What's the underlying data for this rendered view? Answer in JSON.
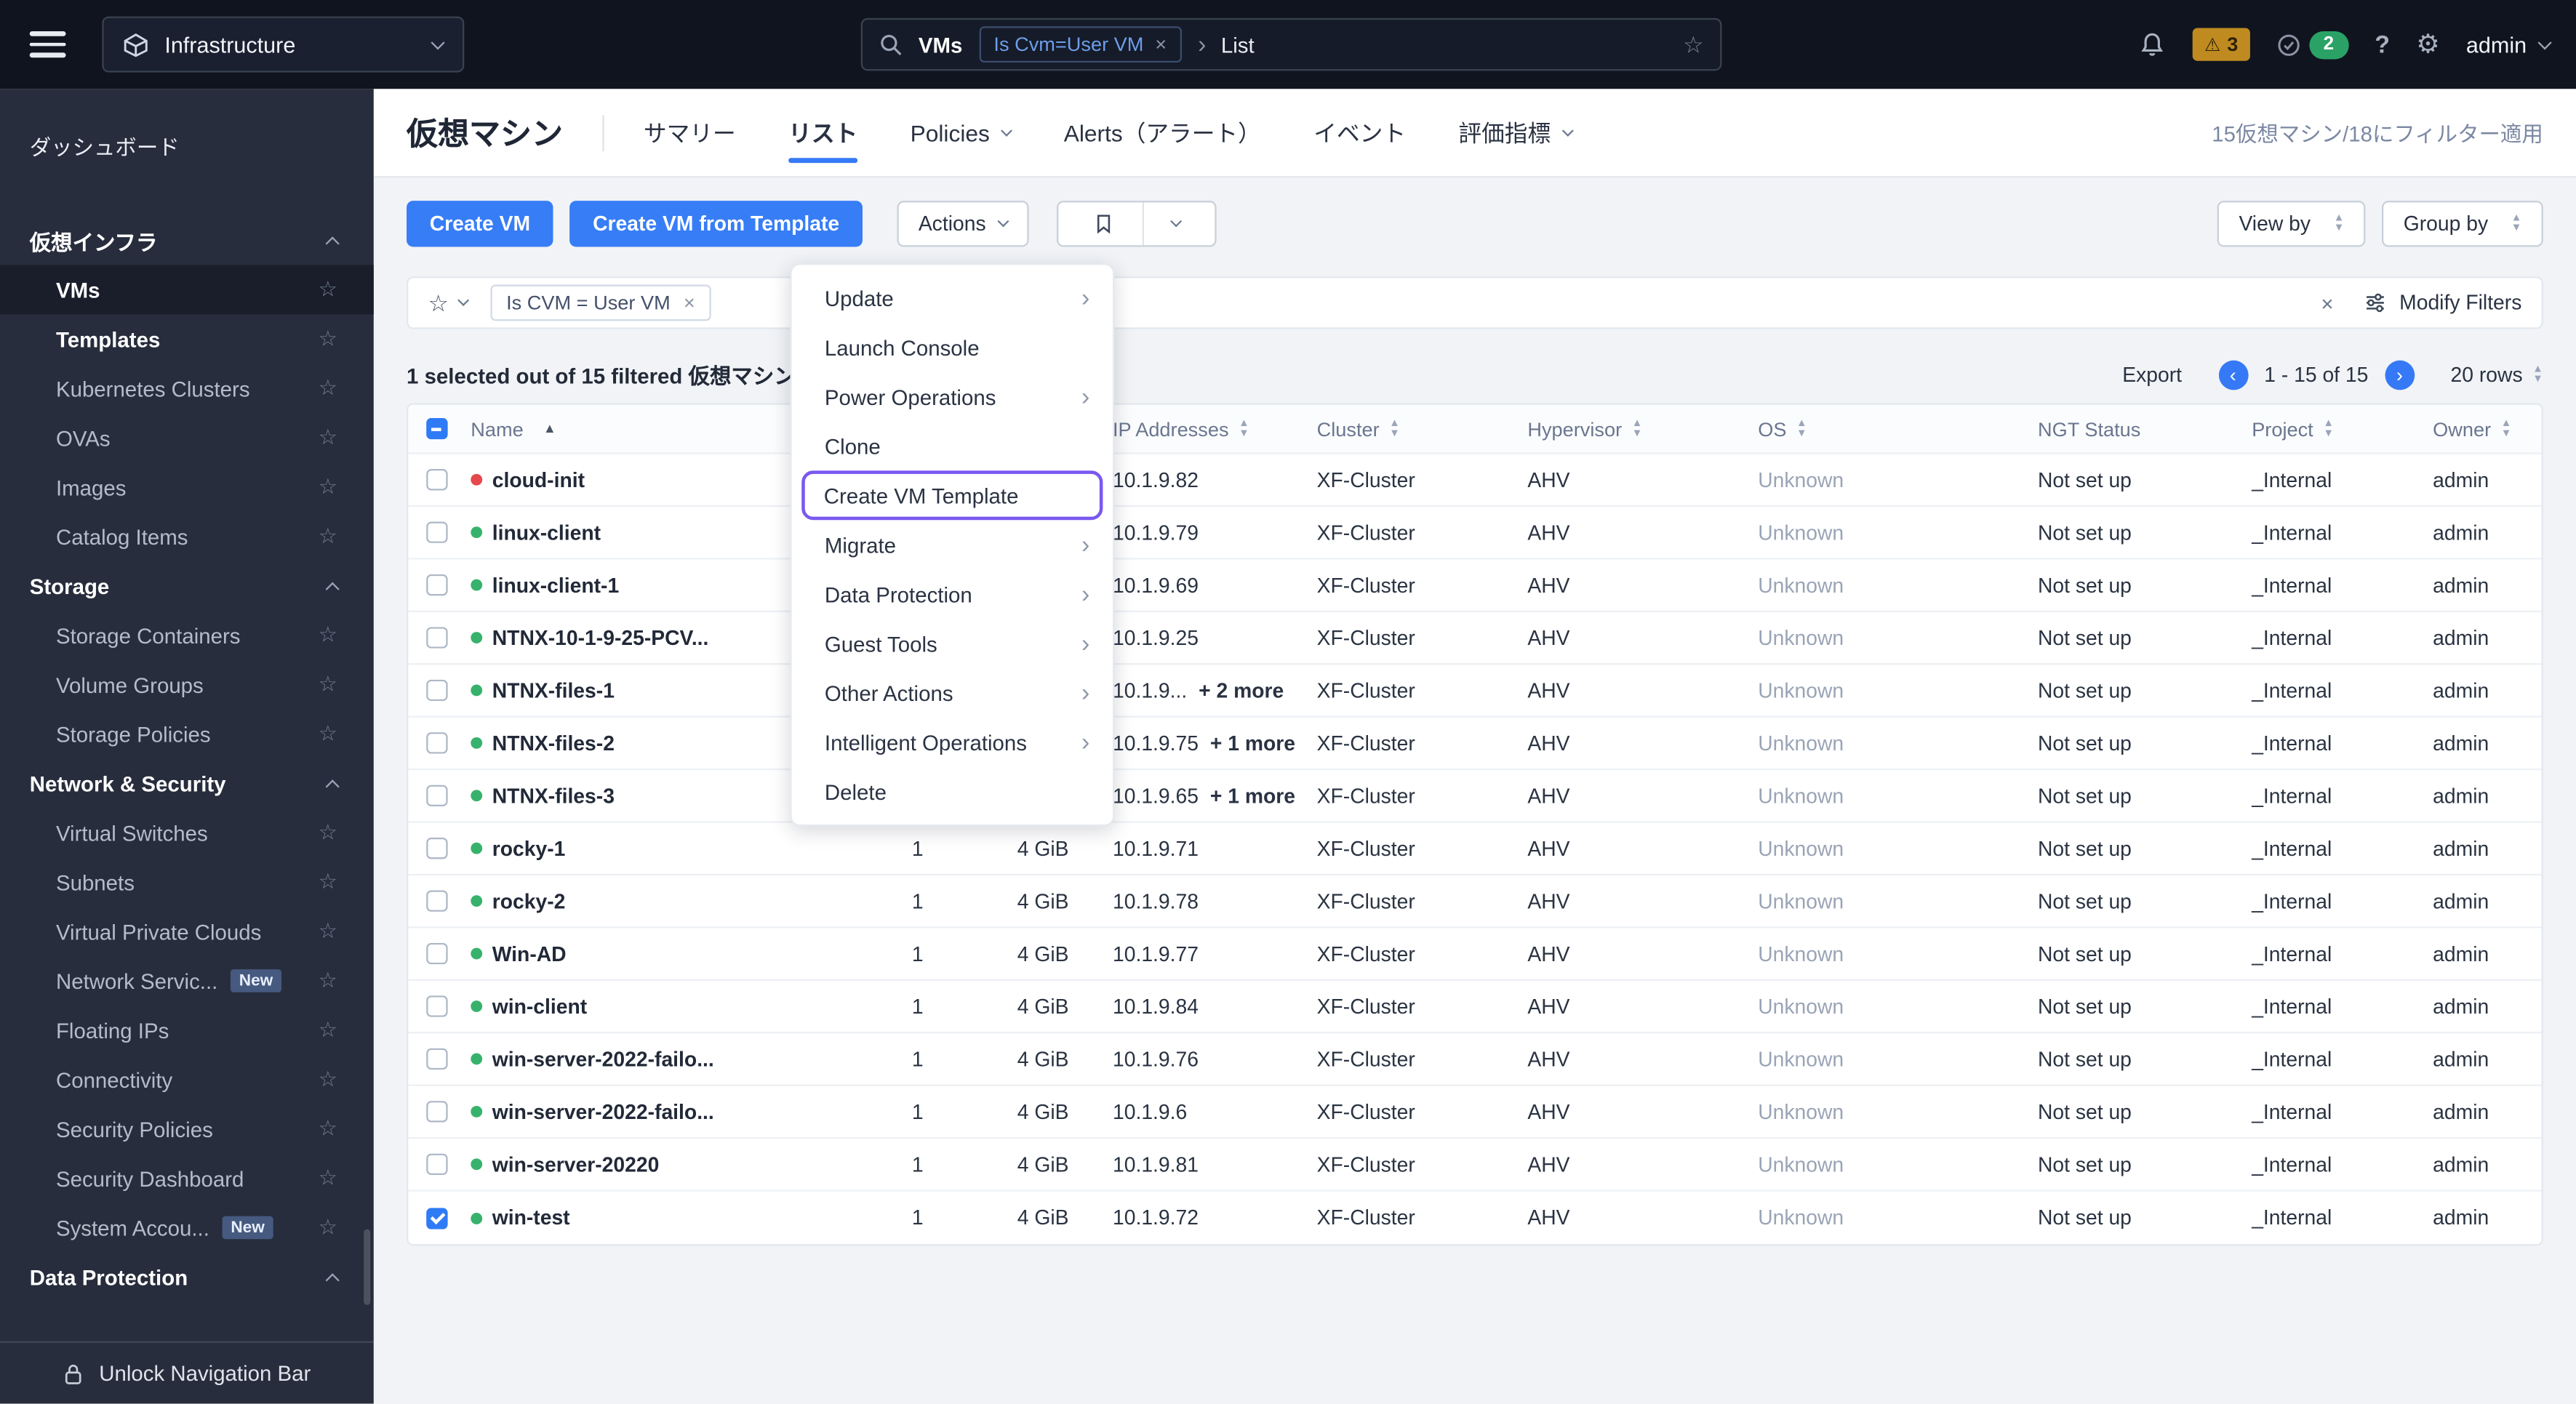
{
  "topbar": {
    "app_label": "Infrastructure",
    "search": {
      "entity": "VMs",
      "tag": "Is Cvm=User VM",
      "crumb": "List"
    },
    "alerts_count": "3",
    "tasks_count": "2",
    "user": "admin"
  },
  "sidebar": {
    "entries": [
      {
        "label": "ダッシュボード",
        "top": true
      },
      {
        "label": "仮想インフラ",
        "header": true
      },
      {
        "label": "VMs",
        "item": true,
        "selected": true,
        "star": true
      },
      {
        "label": "Templates",
        "item": true,
        "bold": true,
        "star": true
      },
      {
        "label": "Kubernetes Clusters",
        "item": true,
        "star": true
      },
      {
        "label": "OVAs",
        "item": true,
        "star": true
      },
      {
        "label": "Images",
        "item": true,
        "star": true
      },
      {
        "label": "Catalog Items",
        "item": true,
        "star": true
      },
      {
        "label": "Storage",
        "header": true
      },
      {
        "label": "Storage Containers",
        "item": true,
        "star": true
      },
      {
        "label": "Volume Groups",
        "item": true,
        "star": true
      },
      {
        "label": "Storage Policies",
        "item": true,
        "star": true
      },
      {
        "label": "Network & Security",
        "header": true
      },
      {
        "label": "Virtual Switches",
        "item": true,
        "star": true
      },
      {
        "label": "Subnets",
        "item": true,
        "star": true
      },
      {
        "label": "Virtual Private Clouds",
        "item": true,
        "star": true
      },
      {
        "label": "Network Servic...",
        "item": true,
        "star": true,
        "new": "New"
      },
      {
        "label": "Floating IPs",
        "item": true,
        "star": true
      },
      {
        "label": "Connectivity",
        "item": true,
        "star": true
      },
      {
        "label": "Security Policies",
        "item": true,
        "star": true
      },
      {
        "label": "Security Dashboard",
        "item": true,
        "star": true
      },
      {
        "label": "System Accou...",
        "item": true,
        "star": true,
        "new": "New"
      },
      {
        "label": "Data Protection",
        "header": true
      }
    ],
    "unlock_label": "Unlock Navigation Bar"
  },
  "page": {
    "title": "仮想マシン",
    "tabs": [
      {
        "label": "サマリー"
      },
      {
        "label": "リスト",
        "active": true
      },
      {
        "label": "Policies",
        "caret": true
      },
      {
        "label": "Alerts（アラート）"
      },
      {
        "label": "イベント"
      },
      {
        "label": "評価指標",
        "caret": true
      }
    ],
    "filter_summary": "15仮想マシン/18にフィルター適用"
  },
  "toolbar": {
    "create_vm": "Create VM",
    "create_vm_from_template": "Create VM from Template",
    "actions": "Actions",
    "view_by": "View by",
    "group_by": "Group by"
  },
  "filterbar": {
    "tag": "Is CVM = User VM",
    "modify_filters": "Modify Filters"
  },
  "listbar": {
    "selection": "1 selected out of 15 filtered 仮想マシン",
    "export": "Export",
    "range": "1 - 15 of 15",
    "rows": "20 rows"
  },
  "actions_menu": {
    "items": [
      {
        "label": "Update",
        "sub": true
      },
      {
        "label": "Launch Console"
      },
      {
        "label": "Power Operations",
        "sub": true
      },
      {
        "label": "Clone"
      },
      {
        "label": "Create VM Template",
        "highlight": true
      },
      {
        "label": "Migrate",
        "sub": true
      },
      {
        "label": "Data Protection",
        "sub": true
      },
      {
        "label": "Guest Tools",
        "sub": true
      },
      {
        "label": "Other Actions",
        "sub": true
      },
      {
        "label": "Intelligent Operations",
        "sub": true
      },
      {
        "label": "Delete"
      }
    ]
  },
  "table": {
    "columns": {
      "name": "Name",
      "ip": "IP Addresses",
      "cluster": "Cluster",
      "hypervisor": "Hypervisor",
      "os": "OS",
      "ngt": "NGT Status",
      "project": "Project",
      "owner": "Owner"
    },
    "rows": [
      {
        "name": "cloud-init",
        "red": true,
        "vcpu": "",
        "memory": "",
        "ip": "10.1.9.82",
        "cluster": "XF-Cluster",
        "hypervisor": "AHV",
        "os": "Unknown",
        "ngt": "Not set up",
        "project": "_Internal",
        "owner": "admin"
      },
      {
        "name": "linux-client",
        "vcpu": "",
        "memory": "",
        "ip": "10.1.9.79",
        "cluster": "XF-Cluster",
        "hypervisor": "AHV",
        "os": "Unknown",
        "ngt": "Not set up",
        "project": "_Internal",
        "owner": "admin"
      },
      {
        "name": "linux-client-1",
        "vcpu": "",
        "memory": "",
        "ip": "10.1.9.69",
        "cluster": "XF-Cluster",
        "hypervisor": "AHV",
        "os": "Unknown",
        "ngt": "Not set up",
        "project": "_Internal",
        "owner": "admin"
      },
      {
        "name": "NTNX-10-1-9-25-PCV...",
        "vcpu": "",
        "memory": "",
        "ip": "10.1.9.25",
        "cluster": "XF-Cluster",
        "hypervisor": "AHV",
        "os": "Unknown",
        "ngt": "Not set up",
        "project": "_Internal",
        "owner": "admin"
      },
      {
        "name": "NTNX-files-1",
        "vcpu": "",
        "memory": "",
        "ip": "10.1.9...",
        "more": "+ 2 more",
        "cluster": "XF-Cluster",
        "hypervisor": "AHV",
        "os": "Unknown",
        "ngt": "Not set up",
        "project": "_Internal",
        "owner": "admin"
      },
      {
        "name": "NTNX-files-2",
        "vcpu": "",
        "memory": "",
        "ip": "10.1.9.75",
        "more": "+ 1 more",
        "cluster": "XF-Cluster",
        "hypervisor": "AHV",
        "os": "Unknown",
        "ngt": "Not set up",
        "project": "_Internal",
        "owner": "admin"
      },
      {
        "name": "NTNX-files-3",
        "vcpu": "",
        "memory": "",
        "ip": "10.1.9.65",
        "more": "+ 1 more",
        "cluster": "XF-Cluster",
        "hypervisor": "AHV",
        "os": "Unknown",
        "ngt": "Not set up",
        "project": "_Internal",
        "owner": "admin"
      },
      {
        "name": "rocky-1",
        "vcpu": "1",
        "memory": "4 GiB",
        "ip": "10.1.9.71",
        "cluster": "XF-Cluster",
        "hypervisor": "AHV",
        "os": "Unknown",
        "ngt": "Not set up",
        "project": "_Internal",
        "owner": "admin"
      },
      {
        "name": "rocky-2",
        "vcpu": "1",
        "memory": "4 GiB",
        "ip": "10.1.9.78",
        "cluster": "XF-Cluster",
        "hypervisor": "AHV",
        "os": "Unknown",
        "ngt": "Not set up",
        "project": "_Internal",
        "owner": "admin"
      },
      {
        "name": "Win-AD",
        "vcpu": "1",
        "memory": "4 GiB",
        "ip": "10.1.9.77",
        "cluster": "XF-Cluster",
        "hypervisor": "AHV",
        "os": "Unknown",
        "ngt": "Not set up",
        "project": "_Internal",
        "owner": "admin"
      },
      {
        "name": "win-client",
        "vcpu": "1",
        "memory": "4 GiB",
        "ip": "10.1.9.84",
        "cluster": "XF-Cluster",
        "hypervisor": "AHV",
        "os": "Unknown",
        "ngt": "Not set up",
        "project": "_Internal",
        "owner": "admin"
      },
      {
        "name": "win-server-2022-failo...",
        "vcpu": "1",
        "memory": "4 GiB",
        "ip": "10.1.9.76",
        "cluster": "XF-Cluster",
        "hypervisor": "AHV",
        "os": "Unknown",
        "ngt": "Not set up",
        "project": "_Internal",
        "owner": "admin"
      },
      {
        "name": "win-server-2022-failo...",
        "vcpu": "1",
        "memory": "4 GiB",
        "ip": "10.1.9.6",
        "cluster": "XF-Cluster",
        "hypervisor": "AHV",
        "os": "Unknown",
        "ngt": "Not set up",
        "project": "_Internal",
        "owner": "admin"
      },
      {
        "name": "win-server-20220",
        "vcpu": "1",
        "memory": "4 GiB",
        "ip": "10.1.9.81",
        "cluster": "XF-Cluster",
        "hypervisor": "AHV",
        "os": "Unknown",
        "ngt": "Not set up",
        "project": "_Internal",
        "owner": "admin"
      },
      {
        "name": "win-test",
        "checked": true,
        "vcpu": "1",
        "memory": "4 GiB",
        "ip": "10.1.9.72",
        "cluster": "XF-Cluster",
        "hypervisor": "AHV",
        "os": "Unknown",
        "ngt": "Not set up",
        "project": "_Internal",
        "owner": "admin"
      }
    ]
  }
}
